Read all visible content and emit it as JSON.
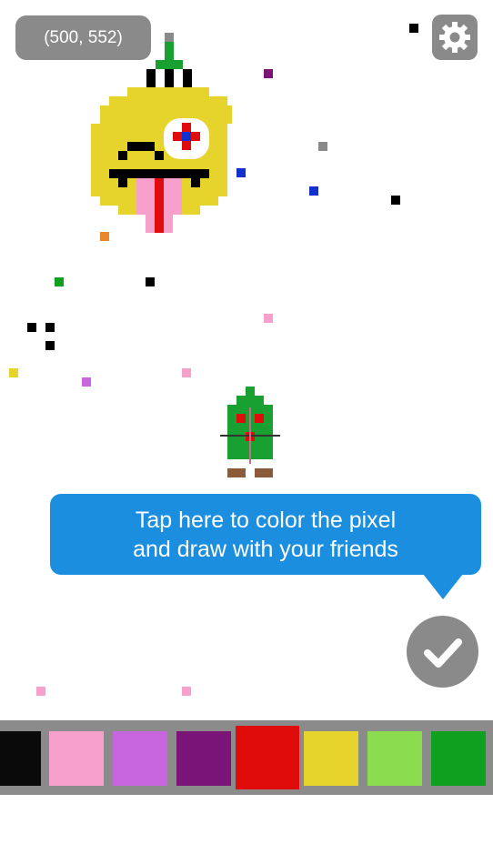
{
  "coordinates": "(500, 552)",
  "tooltip": {
    "line1": "Tap here to color the pixel",
    "line2": "and draw with your friends"
  },
  "icons": {
    "settings": "gear-icon",
    "confirm": "checkmark-icon"
  },
  "palette": [
    {
      "name": "black",
      "color": "#0a0a0a",
      "selected": false
    },
    {
      "name": "pink",
      "color": "#f8a0cc",
      "selected": false
    },
    {
      "name": "violet",
      "color": "#c866e0",
      "selected": false
    },
    {
      "name": "purple",
      "color": "#7a1476",
      "selected": false
    },
    {
      "name": "red",
      "color": "#e00c0c",
      "selected": true
    },
    {
      "name": "yellow",
      "color": "#e6d42c",
      "selected": false
    },
    {
      "name": "light-green",
      "color": "#8cdc50",
      "selected": false
    },
    {
      "name": "green",
      "color": "#10a020",
      "selected": false
    }
  ],
  "colors": {
    "bubble": "#1b8ee0",
    "gray": "#8a8a8a",
    "palette_bg": "#8b8b8b"
  }
}
